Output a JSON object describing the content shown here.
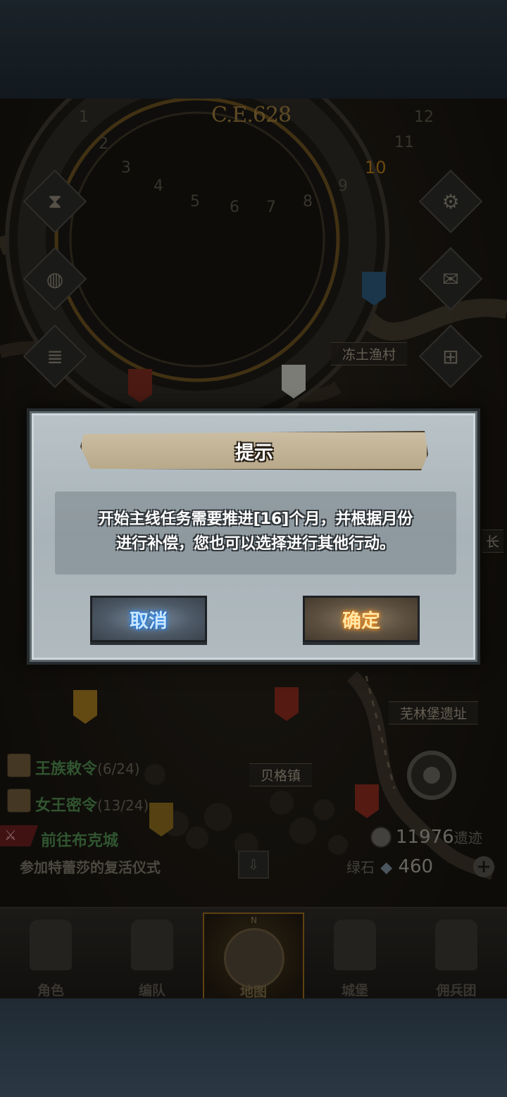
{
  "hud": {
    "year": "C.E.628",
    "month_numbers": [
      "1",
      "2",
      "3",
      "4",
      "5",
      "6",
      "7",
      "8",
      "9",
      "10",
      "11",
      "12"
    ],
    "current_month": "10"
  },
  "map": {
    "places": [
      {
        "label": "冻土渔村"
      },
      {
        "label": "芜林堡遗址"
      },
      {
        "label": "贝格镇"
      },
      {
        "label": "长"
      }
    ]
  },
  "quests": [
    {
      "name": "王族敕令",
      "count": "(6/24)"
    },
    {
      "name": "女王密令",
      "count": "(13/24)"
    },
    {
      "name": "前往布克城",
      "count": ""
    },
    {
      "name": "参加特蕾莎的复活仪式",
      "count": ""
    }
  ],
  "currency": {
    "silver_value": "11976",
    "silver_suffix": "遗迹",
    "gem_label": "绿石",
    "gem_value": "460",
    "add_label": "+"
  },
  "nav": {
    "items": [
      {
        "label": "角色"
      },
      {
        "label": "编队"
      },
      {
        "label": "地图"
      },
      {
        "label": "城堡"
      },
      {
        "label": "佣兵团"
      }
    ],
    "compass_n": "N"
  },
  "dialog": {
    "title": "提示",
    "message_line1": "开始主线任务需要推进[16]个月，并根据月份",
    "message_line2": "进行补偿，您也可以选择进行其他行动。",
    "cancel_label": "取消",
    "confirm_label": "确定"
  },
  "colors": {
    "quest_name": "#4e8a4e",
    "cancel_glow": "#3a9cff",
    "confirm_glow": "#ff9c2a",
    "active_nav_border": "#9a6a1e"
  }
}
